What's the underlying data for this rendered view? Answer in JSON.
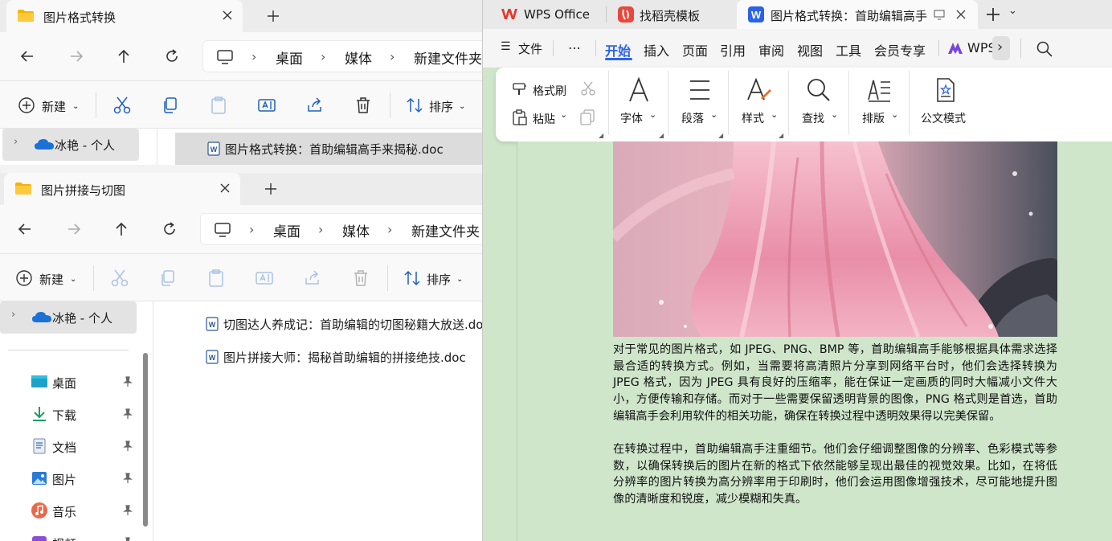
{
  "explorer1": {
    "tab_title": "图片格式转换",
    "breadcrumb": [
      "桌面",
      "媒体",
      "新建文件夹"
    ],
    "toolbar": {
      "new_label": "新建",
      "sort_label": "排序"
    },
    "sidebar_item": "冰艳 - 个人",
    "files": [
      "图片格式转换：首助编辑高手来揭秘.doc"
    ]
  },
  "explorer2": {
    "tab_title": "图片拼接与切图",
    "breadcrumb": [
      "桌面",
      "媒体",
      "新建文件夹"
    ],
    "toolbar": {
      "new_label": "新建",
      "sort_label": "排序"
    },
    "sidebar_item": "冰艳 - 个人",
    "quick_access": [
      {
        "label": "桌面",
        "icon": "desktop-icon"
      },
      {
        "label": "下载",
        "icon": "download-icon"
      },
      {
        "label": "文档",
        "icon": "document-icon"
      },
      {
        "label": "图片",
        "icon": "pictures-icon"
      },
      {
        "label": "音乐",
        "icon": "music-icon"
      },
      {
        "label": "视频",
        "icon": "video-icon"
      }
    ],
    "files": [
      "切图达人养成记：首助编辑的切图秘籍大放送.doc",
      "图片拼接大师：揭秘首助编辑的拼接绝技.doc"
    ]
  },
  "wps": {
    "tabs": [
      "WPS Office",
      "找稻壳模板",
      "图片格式转换：首助编辑高手"
    ],
    "menu": {
      "file": "文件",
      "more": "⋯",
      "items": [
        "开始",
        "插入",
        "页面",
        "引用",
        "审阅",
        "视图",
        "工具",
        "会员专享"
      ],
      "wps_ai": "WPS",
      "active": "开始"
    },
    "ribbon": {
      "format_painter": "格式刷",
      "paste": "粘贴",
      "font": "字体",
      "paragraph": "段落",
      "style": "样式",
      "find": "查找",
      "layout": "排版",
      "official_mode": "公文模式"
    },
    "document": {
      "paragraphs": [
        "对于常见的图片格式，如 JPEG、PNG、BMP 等，首助编辑高手能够根据具体需求选择最合适的转换方式。例如，当需要将高清照片分享到网络平台时，他们会选择转换为 JPEG 格式，因为 JPEG 具有良好的压缩率，能在保证一定画质的同时大幅减小文件大小，方便传输和存储。而对于一些需要保留透明背景的图像，PNG 格式则是首选，首助编辑高手会利用软件的相关功能，确保在转换过程中透明效果得以完美保留。",
        "在转换过程中，首助编辑高手注重细节。他们会仔细调整图像的分辨率、色彩模式等参数，以确保转换后的图片在新的格式下依然能够呈现出最佳的视觉效果。比如，在将低分辨率的图片转换为高分辨率用于印刷时，他们会运用图像增强技术，尽可能地提升图像的清晰度和锐度，减少模糊和失真。"
      ]
    },
    "colors": {
      "accent": "#2b63e6",
      "wps_red": "#e03c2e",
      "page_bg": "#cfe6cb"
    }
  }
}
